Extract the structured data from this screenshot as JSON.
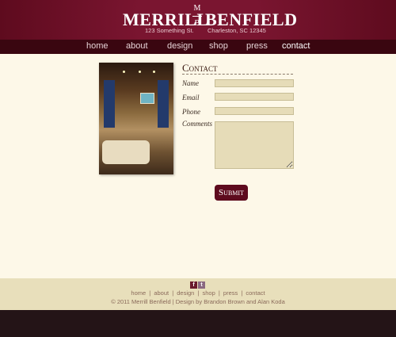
{
  "header": {
    "logo_left": "MERRILL",
    "logo_right": "BENFIELD",
    "monogram_top": "M",
    "monogram_bottom": "B",
    "address_left": "123 Something St.",
    "address_right": "Charleston, SC 12345"
  },
  "nav": {
    "items": [
      "home",
      "about",
      "design",
      "shop",
      "press",
      "contact"
    ],
    "active": "contact"
  },
  "contact": {
    "title": "Contact",
    "name_label": "Name",
    "email_label": "Email",
    "phone_label": "Phone",
    "comments_label": "Comments",
    "submit_label": "Submit"
  },
  "footer": {
    "social": [
      "f",
      "t"
    ],
    "links": [
      "home",
      "about",
      "design",
      "shop",
      "press",
      "contact"
    ],
    "copyright": "© 2011 Merrill Benfield | Design by Brandon Brown and Alan Koda"
  },
  "colors": {
    "brand": "#6b0f24",
    "nav_bg": "#3a0610",
    "page_bg": "#fdf8e8",
    "field_bg": "#e6dcb8",
    "footer_bg": "#e8dfbb",
    "bottom_bar": "#241417"
  },
  "icons": [
    "facebook-icon",
    "twitter-icon"
  ]
}
